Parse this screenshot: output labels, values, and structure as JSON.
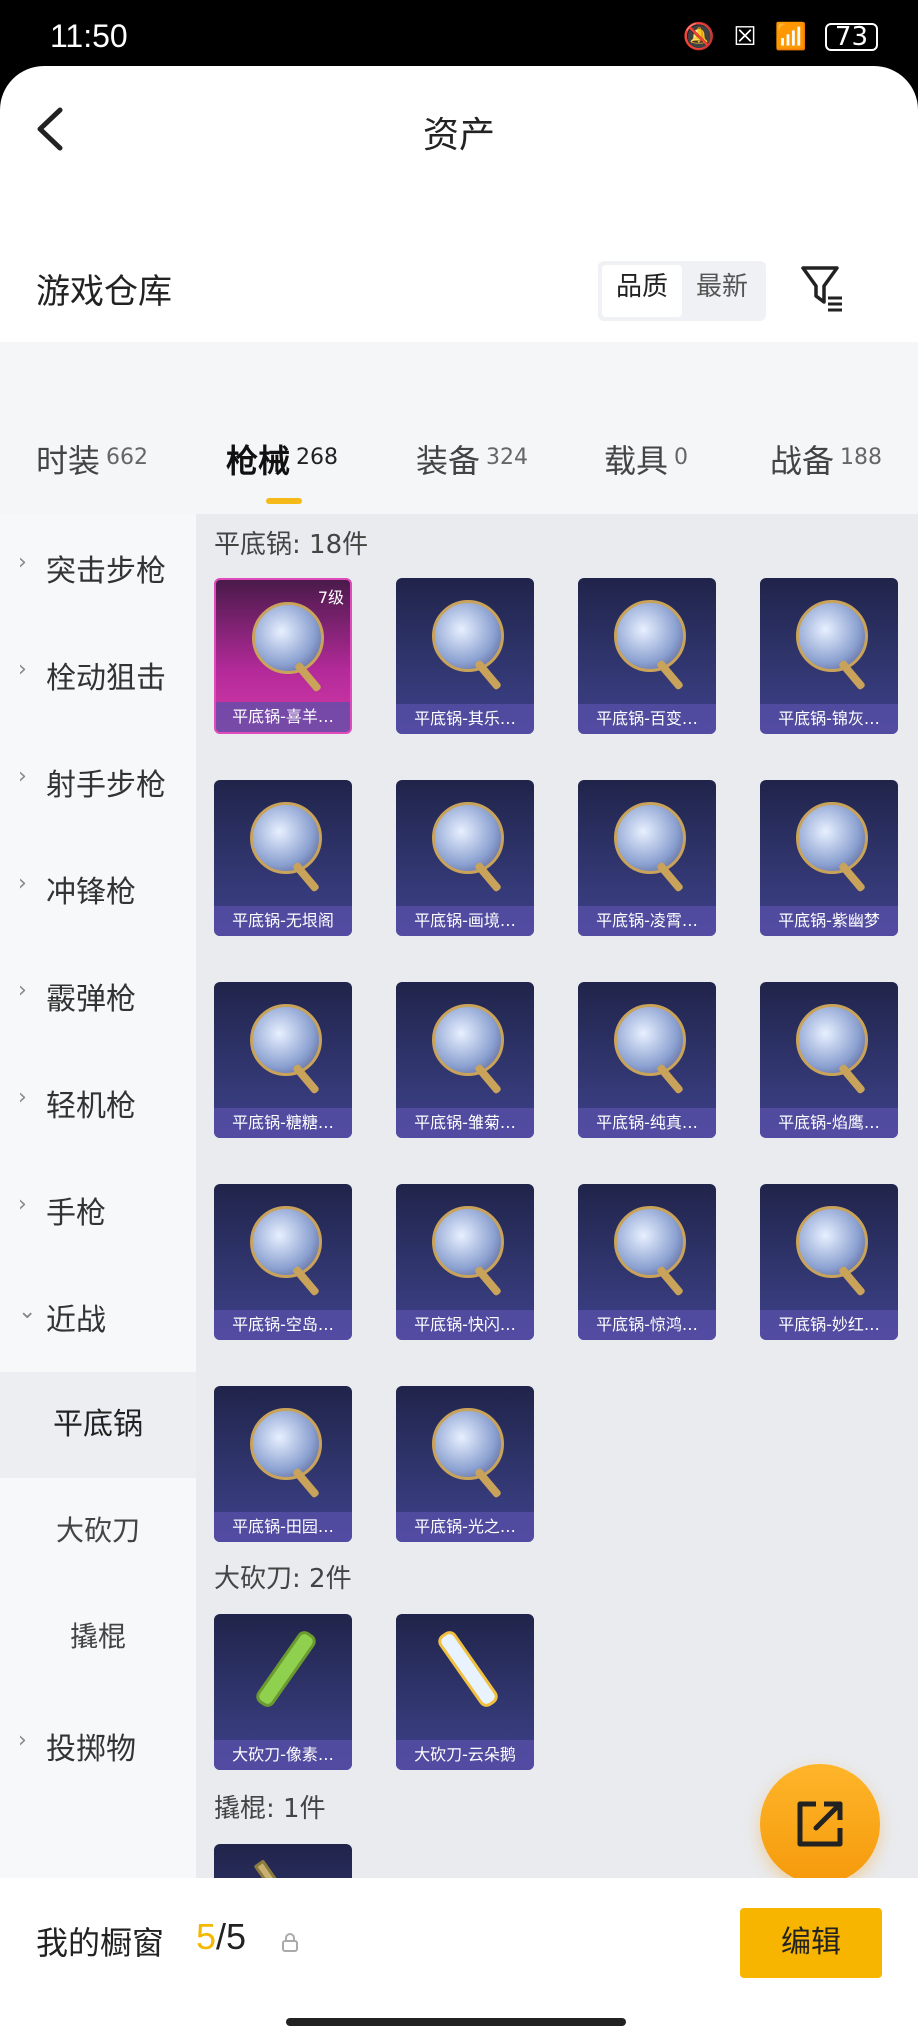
{
  "status": {
    "time": "11:50",
    "battery": "73"
  },
  "header": {
    "title": "资产"
  },
  "warehouse": {
    "title": "游戏仓库",
    "sort_quality": "品质",
    "sort_newest": "最新"
  },
  "tabs": [
    {
      "label": "时装",
      "count": "662"
    },
    {
      "label": "枪械",
      "count": "268"
    },
    {
      "label": "装备",
      "count": "324"
    },
    {
      "label": "载具",
      "count": "0"
    },
    {
      "label": "战备",
      "count": "188"
    }
  ],
  "sidebar": {
    "categories": [
      "突击步枪",
      "栓动狙击",
      "射手步枪",
      "冲锋枪",
      "霰弹枪",
      "轻机枪",
      "手枪",
      "近战",
      "投掷物"
    ],
    "subcategories": [
      "平底锅",
      "大砍刀",
      "撬棍"
    ]
  },
  "sections": [
    {
      "title": "平底锅: 18件",
      "items": [
        {
          "name": "平底锅-喜羊…",
          "level": "7级"
        },
        {
          "name": "平底锅-其乐…"
        },
        {
          "name": "平底锅-百变…"
        },
        {
          "name": "平底锅-锦灰…"
        },
        {
          "name": "平底锅-无垠阁"
        },
        {
          "name": "平底锅-画境…"
        },
        {
          "name": "平底锅-凌霄…"
        },
        {
          "name": "平底锅-紫幽梦"
        },
        {
          "name": "平底锅-糖糖…"
        },
        {
          "name": "平底锅-雏菊…"
        },
        {
          "name": "平底锅-纯真…"
        },
        {
          "name": "平底锅-焰鹰…"
        },
        {
          "name": "平底锅-空岛…"
        },
        {
          "name": "平底锅-快闪…"
        },
        {
          "name": "平底锅-惊鸿…"
        },
        {
          "name": "平底锅-妙红…"
        },
        {
          "name": "平底锅-田园…"
        },
        {
          "name": "平底锅-光之…"
        }
      ]
    },
    {
      "title": "大砍刀: 2件",
      "items": [
        {
          "name": "大砍刀-像素…"
        },
        {
          "name": "大砍刀-云朵鹅"
        }
      ]
    },
    {
      "title": "撬棍: 1件",
      "items": [
        {
          "name": ""
        }
      ]
    }
  ],
  "bottom": {
    "label": "我的橱窗",
    "count_current": "5",
    "count_total": "/5",
    "edit": "编辑"
  },
  "colors": {
    "accent": "#f7b500"
  }
}
